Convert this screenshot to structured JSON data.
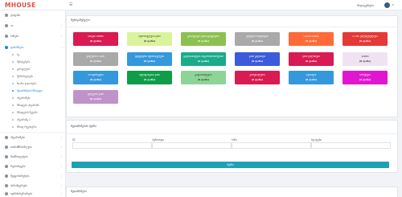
{
  "header": {
    "logo": "MHOUSE",
    "menu_icon": "list-icon",
    "user_name": "შიდაგერცხი"
  },
  "sidebar": {
    "items": [
      {
        "label": "დაფანი",
        "chevron": false
      },
      {
        "label": "ია",
        "chevron": true
      },
      {
        "label": "ბინები",
        "chevron": true
      },
      {
        "label": "ფინანსები",
        "chevron": true,
        "active": true
      }
    ],
    "subitems": [
      {
        "label": "ბკ"
      },
      {
        "label": "შენატენები"
      },
      {
        "label": "გასავლები"
      },
      {
        "label": "შემოსავლები"
      },
      {
        "label": "ზიარი ვალისები"
      },
      {
        "label": "შეთანხმების შრიფდი",
        "current": true
      },
      {
        "label": "ანგარიშები"
      },
      {
        "label": "შრიფები ანგარიში"
      },
      {
        "label": "შრიფების შეტანა"
      },
      {
        "label": "ანგარიშგ 1"
      },
      {
        "label": "შრიფ რეგისტრი"
      }
    ],
    "lower_items": [
      {
        "label": "ანგარიშები"
      },
      {
        "label": "თანამშრომლები"
      },
      {
        "label": "მომწოდებები"
      },
      {
        "label": "რეპორტები"
      },
      {
        "label": "შეტყობინებები"
      },
      {
        "label": "პარამეტრები"
      },
      {
        "label": "ადმინისტრირება"
      }
    ]
  },
  "summary": {
    "title": "შემაჯამებელი",
    "tiles": [
      {
        "name": "ბანკის ნაშთი",
        "value": "(0 ლარი)",
        "color": "#d81b52"
      },
      {
        "name": "შემოსავლები ჯამი",
        "value": "(0 ლარი)",
        "color": "#dcf39e",
        "dark": true
      },
      {
        "name": "გასავლები ჯამი ფაქტიური",
        "value": "(0 ლარი)",
        "color": "#8cc152"
      },
      {
        "name": "ვალები ბინებიდან",
        "value": "(0 ლარი)",
        "color": "#aaa9a9"
      },
      {
        "name": "CODE ნაშთი",
        "value": "(0 ლარი)",
        "color": "#ff6a39"
      },
      {
        "name": "CODE ვალდებულება",
        "value": "(0 ლარი)",
        "color": "#e53935"
      },
      {
        "name": "ვალების CODE",
        "value": "(0 ლარი)",
        "color": "#aaa9a9"
      },
      {
        "name": "ფაქტიური შემოსავლები",
        "value": "(0 ლარი)",
        "color": "#3498db"
      },
      {
        "name": "გადასახადები ანგარიშსწორებით",
        "value": "(0 ლარი)",
        "color": "#1aab8a"
      },
      {
        "name": "ჯამი გადახდა",
        "value": "(0 ლარი)",
        "color": "#3b5bdb"
      },
      {
        "name": "ჯამი ვალისები",
        "value": "(0 ლარი)",
        "color": "#d81b52"
      },
      {
        "name": "ნაშთი",
        "value": "(0 ლარი)",
        "color": "#efe3f2",
        "dark": true
      },
      {
        "name": "ას შემოსვლა",
        "value": "(0 ლარი)",
        "color": "#3498db"
      },
      {
        "name": "ხელფასების ჯამი",
        "value": "(0 ლარი)",
        "color": "#109d4a"
      },
      {
        "name": "გადასახდელი",
        "value": "(0 ლარი)",
        "color": "#8ed497",
        "dark": true
      },
      {
        "name": "კომუნალური",
        "value": "(0 ლარი)",
        "color": "#d81b52"
      },
      {
        "name": "ავანსები",
        "value": "(0 ლარი)",
        "color": "#3498db"
      },
      {
        "name": "ბონუსები",
        "value": "(0 ლარი)",
        "color": "#e117cf"
      },
      {
        "name": "ვალების ჯამი",
        "value": "(0 ლარი)",
        "color": "#bf93c9"
      }
    ]
  },
  "filter": {
    "title": "შეთანხმების ძებნა",
    "fields": [
      {
        "label": "ID"
      },
      {
        "label": "პერიოდი"
      },
      {
        "label": "ბინა"
      },
      {
        "label": "სტატუსი"
      }
    ],
    "button": "ძებნა"
  },
  "list": {
    "title": "შეთანხმები"
  }
}
